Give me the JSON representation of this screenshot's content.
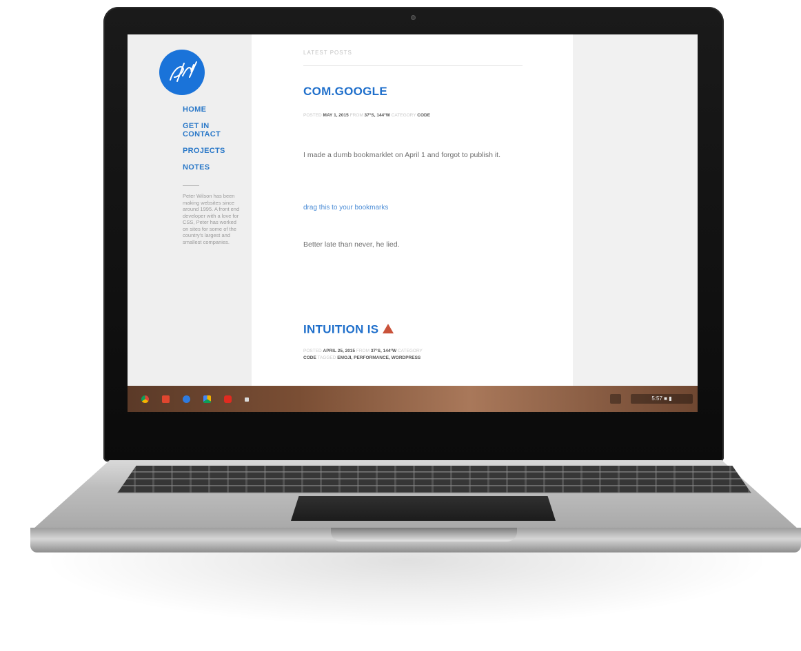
{
  "sidebar": {
    "logo_alt": "PW",
    "nav": [
      "HOME",
      "GET IN CONTACT",
      "PROJECTS",
      "NOTES"
    ],
    "bio": "Peter Wilson has been making websites since around 1995. A front end developer with a love for CSS, Peter has worked on sites for some of the country's largest and smallest companies."
  },
  "main": {
    "section_label": "LATEST POSTS",
    "posts": [
      {
        "title": "COM.GOOGLE",
        "meta_posted_label": "POSTED",
        "meta_date": "MAY 1, 2015",
        "meta_from_label": "FROM",
        "meta_location": "37°S, 144°W",
        "meta_category_label": "CATEGORY",
        "meta_category": "CODE",
        "paragraph1": "I made a dumb bookmarklet on April 1 and forgot to publish it.",
        "link": "drag this to your bookmarks",
        "paragraph2": "Better late than never, he lied."
      },
      {
        "title": "INTUITION IS",
        "meta_posted_label": "POSTED",
        "meta_date": "APRIL 25, 2015",
        "meta_from_label": "FROM",
        "meta_location": "37°S, 144°W",
        "meta_category_label": "CATEGORY",
        "meta_category": "CODE",
        "meta_tagged_label": "TAGGED",
        "meta_tags": "EMOJI, PERFORMANCE, WORDPRESS"
      }
    ]
  },
  "shelf": {
    "apps": [
      "chrome-icon",
      "gmail-icon",
      "search-icon",
      "drive-icon",
      "youtube-icon",
      "apps-icon"
    ],
    "tray_time": "5:57"
  },
  "colors": {
    "accent": "#1f6fcb",
    "logo": "#1a73d9",
    "shelf": "#7a4e34"
  }
}
